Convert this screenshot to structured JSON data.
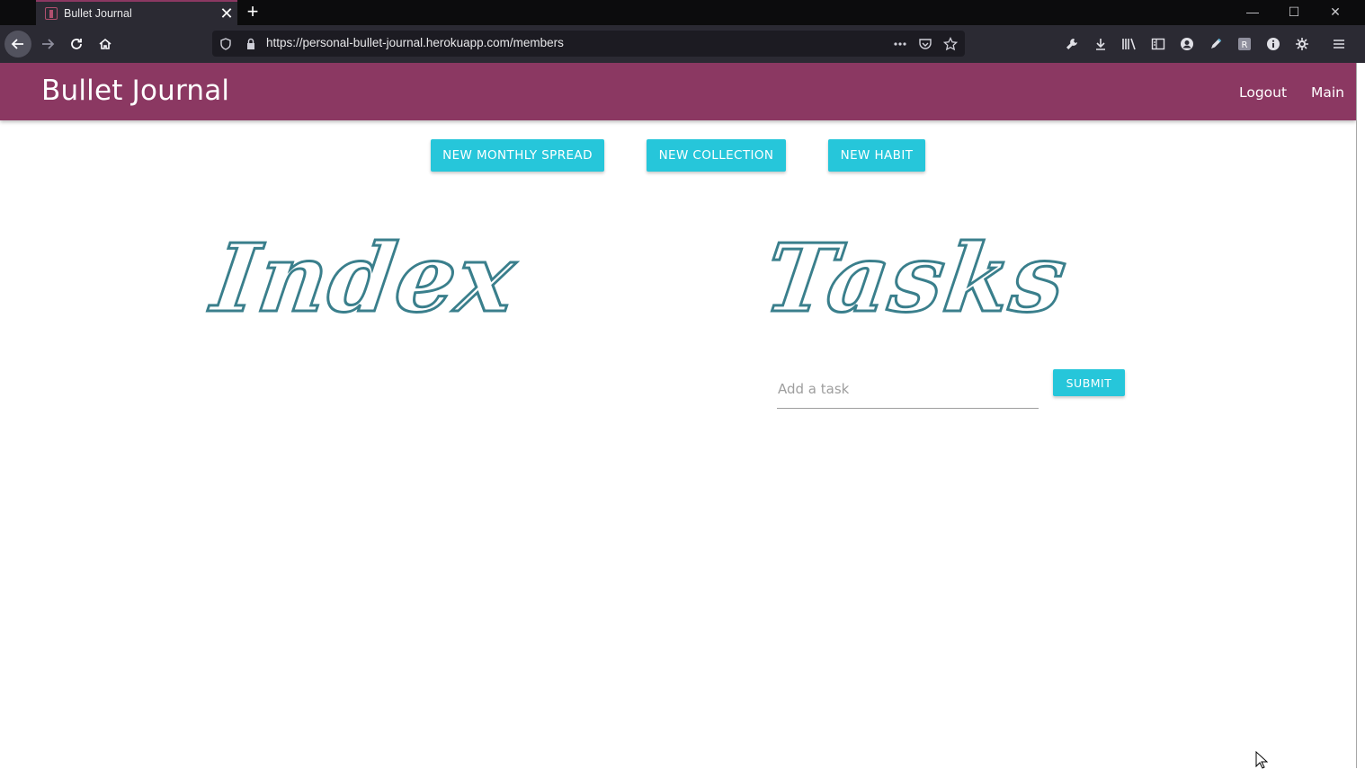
{
  "browser": {
    "tab_title": "Bullet Journal",
    "tab_close": "✕",
    "new_tab": "+",
    "url": "https://personal-bullet-journal.herokuapp.com/members",
    "window_controls": [
      "—",
      "☐",
      "✕"
    ],
    "toolbar_icons": [
      "wrench-icon",
      "download-icon",
      "library-icon",
      "sidebar-icon",
      "account-icon",
      "pen-icon",
      "extension-icon",
      "info-icon",
      "gear-extension-icon",
      "menu-icon"
    ]
  },
  "app": {
    "brand": "Bullet Journal",
    "nav": {
      "logout": "Logout",
      "main": "Main"
    },
    "actions": {
      "new_monthly_spread": "New Monthly Spread",
      "new_collection": "New Collection",
      "new_habit": "New Habit"
    },
    "index_heading": "Index",
    "tasks_heading": "Tasks",
    "task_input": {
      "placeholder": "Add a task",
      "value": ""
    },
    "submit": "Submit"
  },
  "colors": {
    "header": "#8b3862",
    "button": "#26c6da",
    "script_heading": "#3a7f8c"
  }
}
